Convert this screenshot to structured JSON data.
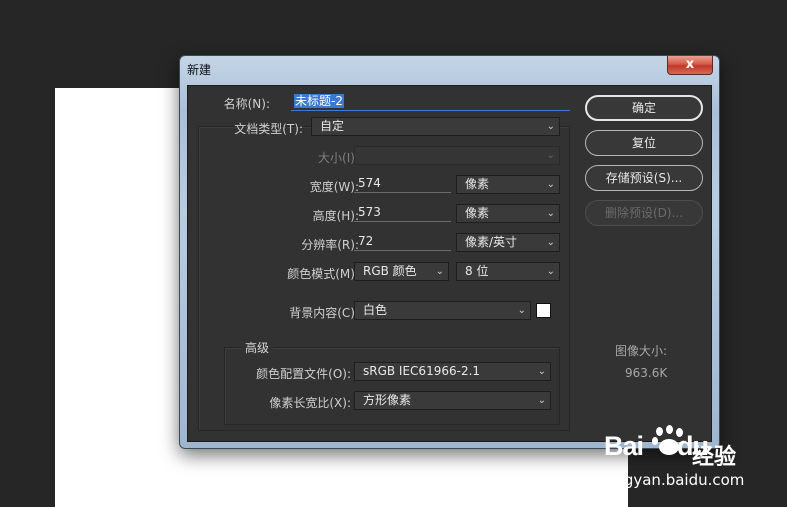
{
  "dialog": {
    "title": "新建",
    "close_label": "x"
  },
  "form": {
    "name": {
      "label": "名称(N):",
      "value": "未标题-2"
    },
    "preset": {
      "label": "文档类型(T):",
      "value": "自定"
    },
    "size": {
      "label": "大小(I):",
      "value": ""
    },
    "width": {
      "label": "宽度(W):",
      "value": "574",
      "unit": "像素"
    },
    "height": {
      "label": "高度(H):",
      "value": "573",
      "unit": "像素"
    },
    "resolution": {
      "label": "分辨率(R):",
      "value": "72",
      "unit": "像素/英寸"
    },
    "color_mode": {
      "label": "颜色模式(M):",
      "value": "RGB 颜色",
      "depth": "8 位"
    },
    "background": {
      "label": "背景内容(C):",
      "value": "白色",
      "swatch_color": "#ffffff"
    },
    "advanced": {
      "title": "高级",
      "profile": {
        "label": "颜色配置文件(O):",
        "value": "sRGB IEC61966-2.1"
      },
      "aspect": {
        "label": "像素长宽比(X):",
        "value": "方形像素"
      }
    }
  },
  "buttons": {
    "ok": "确定",
    "reset": "复位",
    "save_preset": "存储预设(S)...",
    "delete_preset": "删除预设(D)..."
  },
  "image_size": {
    "label": "图像大小:",
    "value": "963.6K"
  },
  "watermark": {
    "logo": "Bai",
    "logo_tail": "du",
    "text": "经验",
    "url": "jingyan.baidu.com"
  },
  "colors": {
    "dialog_bg": "#323232",
    "accent": "#3a78d2",
    "canvas": "#ffffff",
    "workspace": "#262626"
  }
}
